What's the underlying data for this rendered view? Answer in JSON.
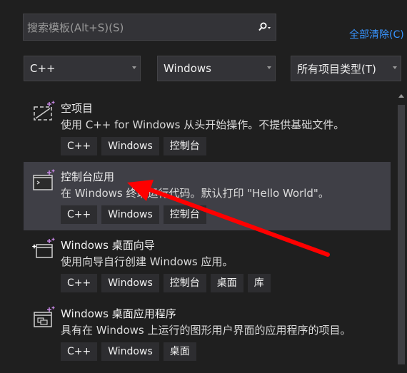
{
  "search": {
    "placeholder": "搜索模板(Alt+S)(S)"
  },
  "clear_filter": "全部清除(C)",
  "filters": [
    {
      "value": "C++"
    },
    {
      "value": "Windows"
    },
    {
      "value": "所有项目类型(T)"
    }
  ],
  "templates": [
    {
      "title": "空项目",
      "desc": "使用 C++ for Windows 从头开始操作。不提供基础文件。",
      "tags": [
        "C++",
        "Windows",
        "控制台"
      ]
    },
    {
      "title": "控制台应用",
      "desc": "在 Windows 终端运行代码。默认打印 \"Hello World\"。",
      "tags": [
        "C++",
        "Windows",
        "控制台"
      ]
    },
    {
      "title": "Windows 桌面向导",
      "desc": "使用向导自行创建 Windows 应用。",
      "tags": [
        "C++",
        "Windows",
        "控制台",
        "桌面",
        "库"
      ]
    },
    {
      "title": "Windows 桌面应用程序",
      "desc": "具有在 Windows 上运行的图形用户界面的应用程序的项目。",
      "tags": [
        "C++",
        "Windows",
        "桌面"
      ]
    }
  ],
  "colors": {
    "accent": "#3794ff",
    "selected": "#3f3f46",
    "annotation": "#ff0000"
  }
}
